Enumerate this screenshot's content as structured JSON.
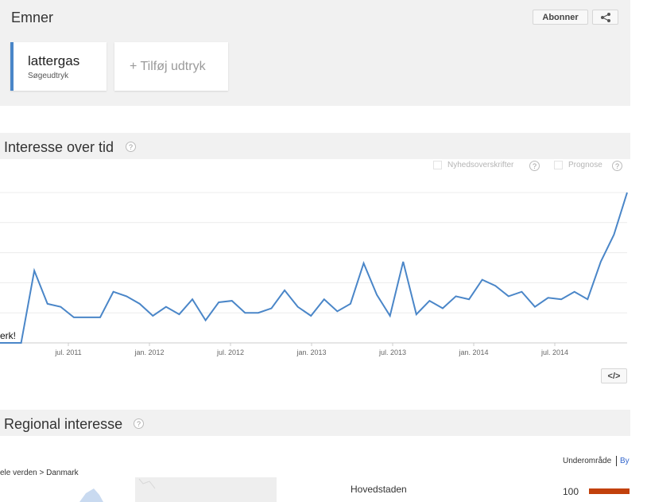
{
  "topics": {
    "title": "Emner",
    "subscribe_label": "Abonner",
    "terms": [
      {
        "name": "lattergas",
        "type": "Søgeudtryk"
      }
    ],
    "add_term_label": "+ Tilføj udtryk"
  },
  "interest_over_time": {
    "title": "Interesse over tid",
    "help": "?",
    "headlines_label": "Nyhedsoverskrifter",
    "forecast_label": "Prognose",
    "note_text": "erk!",
    "embed_label": "</>"
  },
  "regional": {
    "title": "Regional interesse",
    "help": "?",
    "breadcrumb": "ele verden > Danmark",
    "view_toggle_active": "Underområde",
    "view_toggle_other": "By",
    "regions": [
      {
        "name": "Hovedstaden",
        "value": 100
      }
    ]
  },
  "colors": {
    "line": "#4a86c8",
    "bar": "#c2410c",
    "accent": "#4a86c8"
  },
  "chart_data": {
    "type": "line",
    "x_ticks": [
      "jul. 2011",
      "jan. 2012",
      "jul. 2012",
      "jan. 2013",
      "jul. 2013",
      "jan. 2014",
      "jul. 2014"
    ],
    "series": [
      {
        "values": [
          0,
          0,
          48,
          26,
          24,
          17,
          17,
          17,
          34,
          31,
          26,
          18,
          24,
          19,
          29,
          15,
          27,
          28,
          20,
          20,
          23,
          35,
          24,
          18,
          29,
          21,
          26,
          53,
          32,
          18,
          54,
          19,
          28,
          23,
          31,
          29,
          42,
          38,
          31,
          34,
          24,
          30,
          29,
          34,
          29,
          54,
          72,
          100
        ]
      }
    ],
    "ylim": [
      0,
      100
    ],
    "grid": true
  }
}
